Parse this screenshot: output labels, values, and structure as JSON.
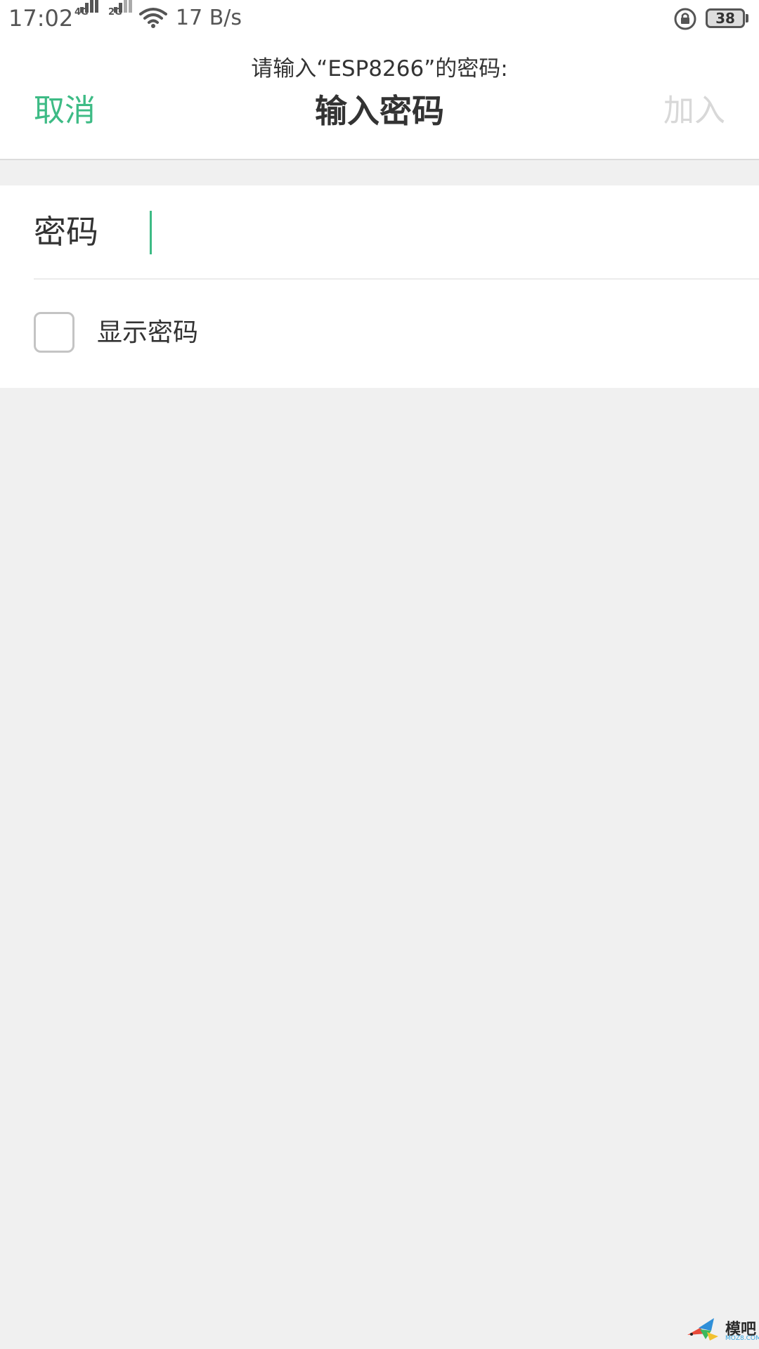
{
  "status_bar": {
    "time": "17:02",
    "network_1": "4G",
    "network_2": "2G",
    "speed": "17 B/s",
    "battery": "38",
    "icons": [
      "signal-4g-icon",
      "signal-2g-icon",
      "wifi-icon",
      "rotation-lock-icon",
      "battery-icon"
    ]
  },
  "header": {
    "subtitle": "请输入“ESP8266”的密码:",
    "title": "输入密码",
    "cancel_label": "取消",
    "join_label": "加入"
  },
  "form": {
    "password_label": "密码",
    "password_value": "",
    "show_password_label": "显示密码",
    "show_password_checked": false
  },
  "watermark": {
    "text": "模吧",
    "sub": "MOZ8.COM"
  },
  "colors": {
    "accent": "#3dbb85",
    "disabled": "#d8d8d8",
    "background": "#f0f0f0"
  }
}
